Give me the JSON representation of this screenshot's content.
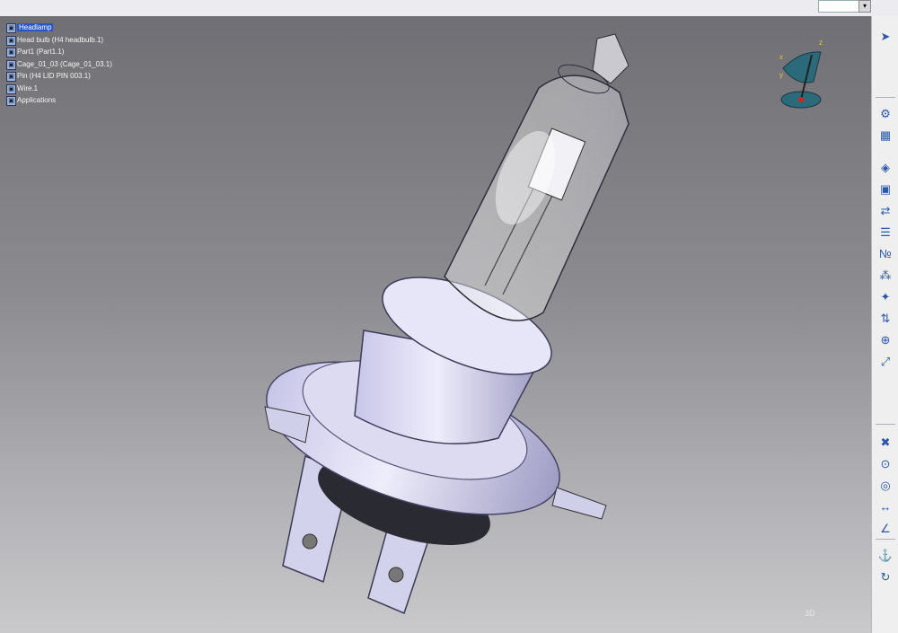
{
  "zoom": {
    "value": ""
  },
  "tree": {
    "root": "Headlamp",
    "children": [
      "Head bulb (H4 headbulb.1)",
      "Part1 (Part1.1)",
      "Cage_01_03 (Cage_01_03.1)",
      "Pin (H4 LID PIN 003.1)",
      "Wire.1",
      "Applications"
    ]
  },
  "toolbar": {
    "icons": [
      "select-icon",
      "assembly-icon",
      "product-icon",
      "part-icon",
      "existing-component-icon",
      "replace-icon",
      "graph-tree-icon",
      "generate-numbering-icon",
      "multi-instantiation-icon",
      "fast-multi-instantiation-icon",
      "reorder-icon",
      "snap-icon",
      "explode-icon",
      "clash-icon",
      "coincidence-constraint-icon",
      "contact-constraint-icon",
      "offset-constraint-icon",
      "angle-constraint-icon",
      "fix-icon",
      "update-icon"
    ]
  },
  "compass": {
    "axis_x": "x",
    "axis_y": "y",
    "axis_z": "z"
  },
  "status": {
    "coord": "3D"
  }
}
